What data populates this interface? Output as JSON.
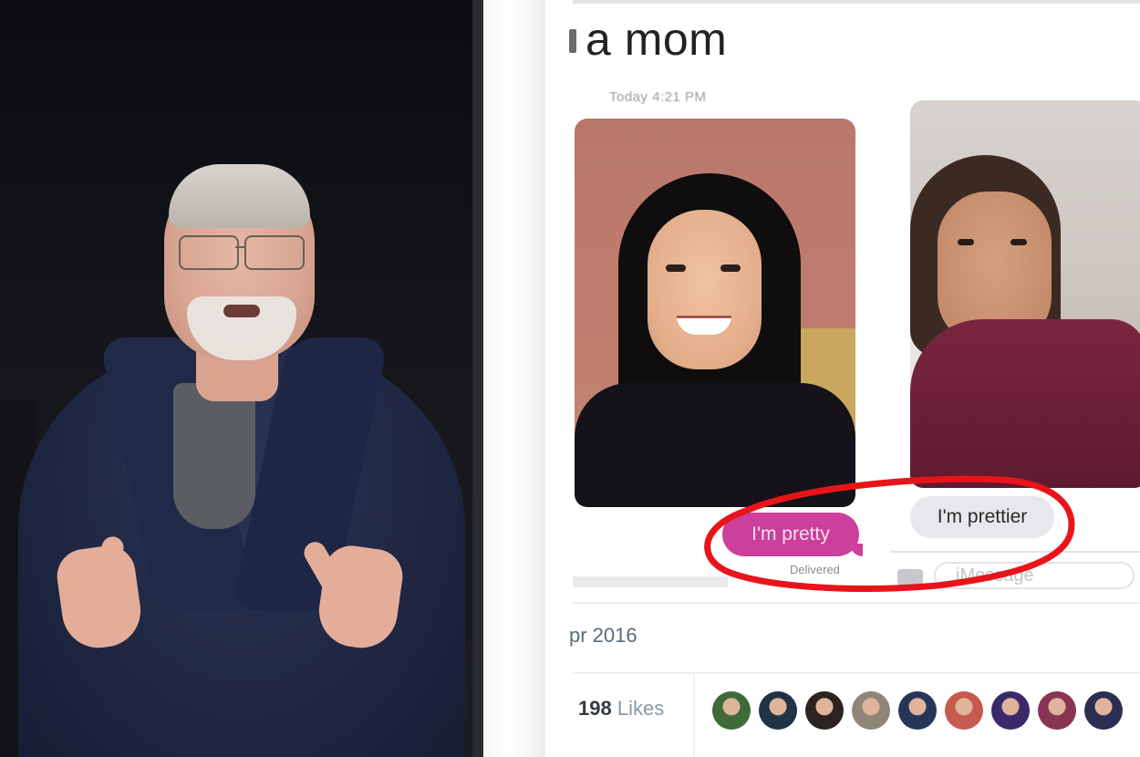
{
  "left_photo": {},
  "post": {
    "title": "a mom",
    "timestamp": "Today 4:21 PM",
    "message_sent": "I'm pretty",
    "message_status": "Delivered",
    "message_received": "I'm prettier",
    "input_placeholder": "iMessage",
    "date": "pr 2016",
    "likes_count": "198",
    "likes_label": "Likes"
  },
  "annotation": {
    "color": "#e8141a"
  },
  "colors": {
    "sent_bubble": "#cc3f9a",
    "received_bubble": "#e8e8ec"
  },
  "avatars": [
    {
      "color": "#3f6a3a"
    },
    {
      "color": "#223347"
    },
    {
      "color": "#2b2320"
    },
    {
      "color": "#8f8678"
    },
    {
      "color": "#263659"
    },
    {
      "color": "#c65a4e"
    },
    {
      "color": "#3a2a6a"
    },
    {
      "color": "#8a3453"
    },
    {
      "color": "#2a2f52"
    }
  ]
}
